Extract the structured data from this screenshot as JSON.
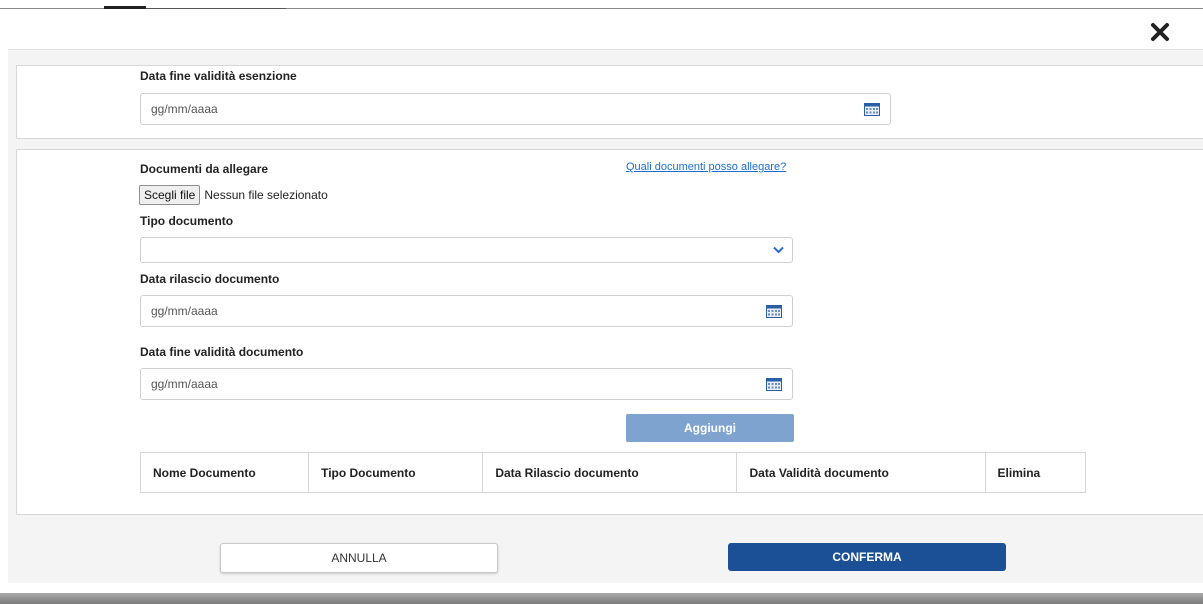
{
  "exemption_section": {
    "end_date_label": "Data fine validità esenzione",
    "end_date_placeholder": "gg/mm/aaaa"
  },
  "documents_section": {
    "attach_label": "Documenti da allegare",
    "help_link": "Quali documenti posso allegare?",
    "choose_file_button": "Scegli file",
    "no_file_text": "Nessun file selezionato",
    "doc_type_label": "Tipo documento",
    "doc_type_value": "",
    "issue_date_label": "Data rilascio documento",
    "issue_date_placeholder": "gg/mm/aaaa",
    "doc_end_date_label": "Data fine validità documento",
    "doc_end_date_placeholder": "gg/mm/aaaa",
    "add_button": "Aggiungi"
  },
  "table": {
    "columns": [
      "Nome Documento",
      "Tipo Documento",
      "Data Rilascio documento",
      "Data Validità documento",
      "Elimina"
    ]
  },
  "footer": {
    "cancel_button": "ANNULLA",
    "confirm_button": "CONFERMA"
  },
  "icons": {
    "close": "close-icon",
    "calendar": "calendar-icon",
    "dropdown": "chevron-down-icon"
  },
  "colors": {
    "primary": "#1b4f96",
    "add_button": "#7fa3cf",
    "link": "#1a6ed1",
    "chevron": "#2a6ac8"
  }
}
